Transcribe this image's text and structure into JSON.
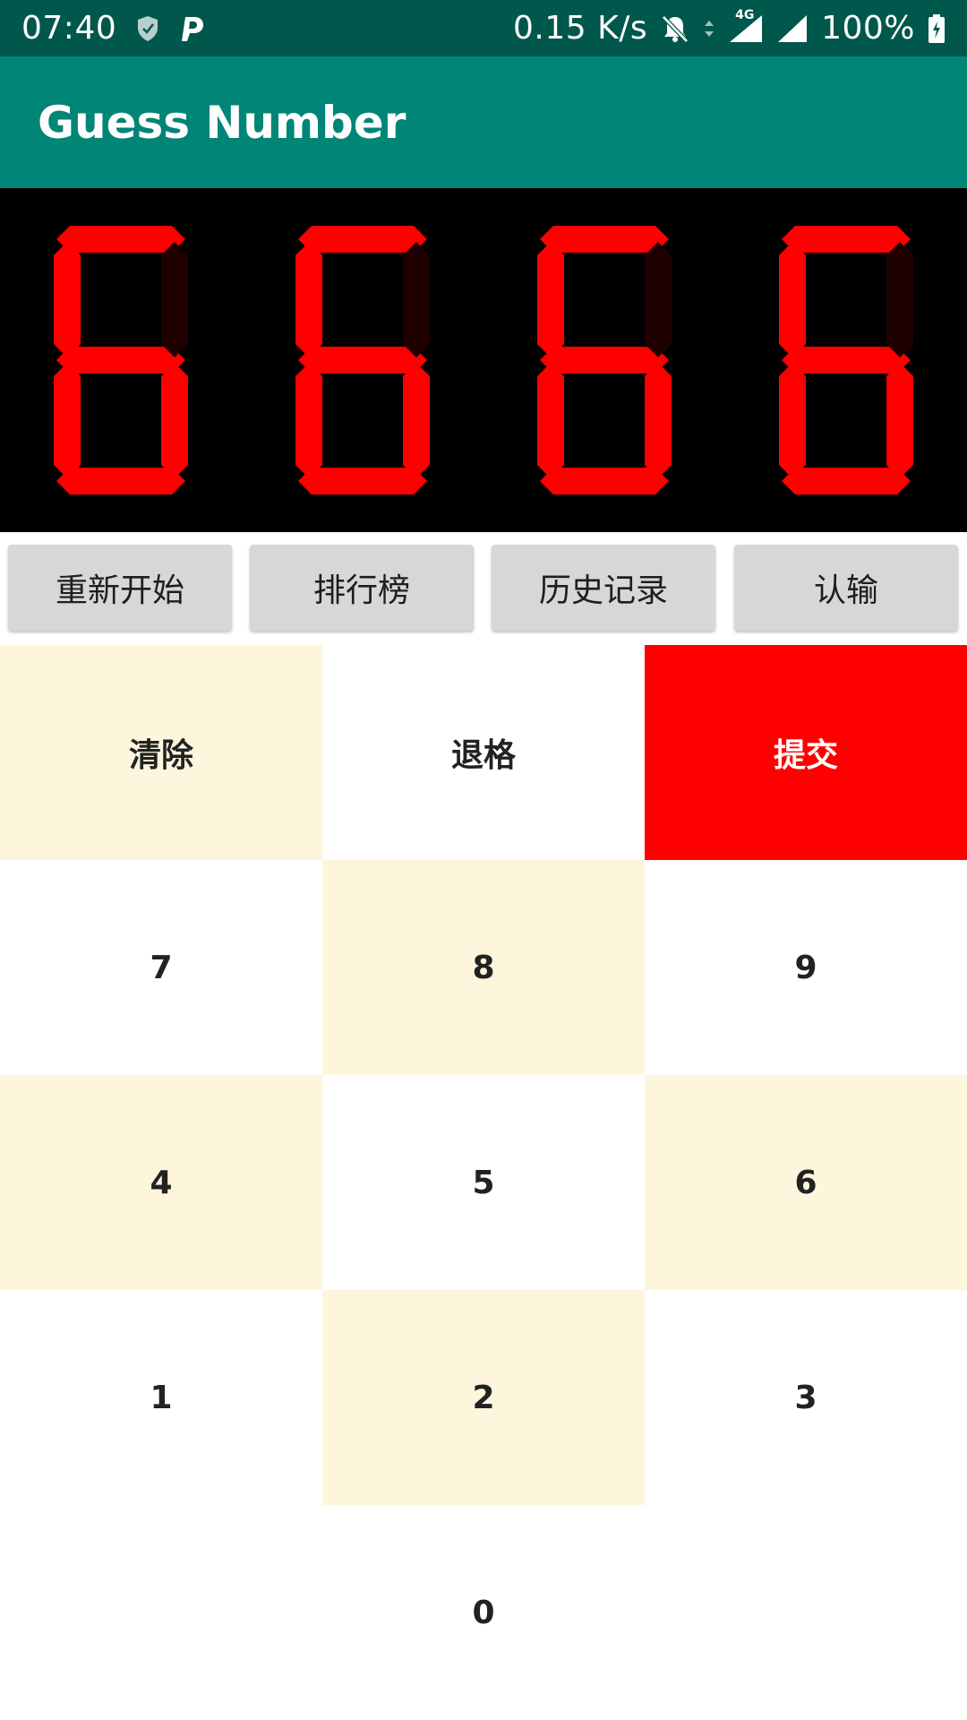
{
  "status_bar": {
    "time": "07:40",
    "net_speed": "0.15 K/s",
    "network_type": "4G",
    "battery": "100%",
    "icons": [
      "shield-icon",
      "p-app-icon",
      "bell-off-icon",
      "data-arrows-icon",
      "signal-icon",
      "battery-charging-icon"
    ]
  },
  "app_bar": {
    "title": "Guess Number"
  },
  "display": {
    "digits": [
      "6",
      "6",
      "6",
      "6"
    ],
    "segment_on_color": "#ff0000",
    "segment_off_color": "#1f0000",
    "background": "#000000"
  },
  "actions": {
    "restart": "重新开始",
    "leaderboard": "排行榜",
    "history": "历史记录",
    "give_up": "认输"
  },
  "keypad": {
    "clear": "清除",
    "backspace": "退格",
    "submit": "提交",
    "k7": "7",
    "k8": "8",
    "k9": "9",
    "k4": "4",
    "k5": "5",
    "k6": "6",
    "k1": "1",
    "k2": "2",
    "k3": "3",
    "k0": "0"
  },
  "colors": {
    "status_bar": "#00574b",
    "app_bar": "#008577",
    "key_cream": "#fdf6dd",
    "key_submit": "#ff0000",
    "action_button": "#d6d7d7"
  }
}
